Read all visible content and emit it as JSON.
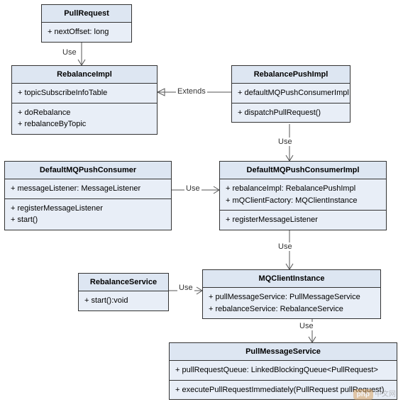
{
  "classes": {
    "pullRequest": {
      "name": "PullRequest",
      "attrs": [
        "+ nextOffset: long"
      ]
    },
    "rebalanceImpl": {
      "name": "RebalanceImpl",
      "attrs": [
        "+ topicSubscribeInfoTable"
      ],
      "methods": [
        "+ doRebalance",
        "+ rebalanceByTopic"
      ]
    },
    "rebalancePushImpl": {
      "name": "RebalancePushImpl",
      "attrs": [
        "+ defaultMQPushConsumerImpl"
      ],
      "methods": [
        "+ dispatchPullRequest()"
      ]
    },
    "defaultMQPushConsumer": {
      "name": "DefaultMQPushConsumer",
      "attrs": [
        "+ messageListener: MessageListener"
      ],
      "methods": [
        "+ registerMessageListener",
        "+ start()"
      ]
    },
    "defaultMQPushConsumerImpl": {
      "name": "DefaultMQPushConsumerImpl",
      "attrs": [
        "+ rebalanceImpl: RebalancePushImpl",
        "+ mQClientFactory:  MQClientInstance"
      ],
      "methods": [
        "+ registerMessageListener"
      ]
    },
    "rebalanceService": {
      "name": "RebalanceService",
      "methods": [
        "+ start():void"
      ]
    },
    "mqClientInstance": {
      "name": "MQClientInstance",
      "attrs": [
        "+ pullMessageService: PullMessageService",
        "+ rebalanceService: RebalanceService"
      ]
    },
    "pullMessageService": {
      "name": "PullMessageService",
      "attrs": [
        "+ pullRequestQueue: LinkedBlockingQueue<PullRequest>"
      ],
      "methods": [
        "+ executePullRequestImmediately(PullRequest pullRequest)"
      ]
    }
  },
  "labels": {
    "use": "Use",
    "extends": "Extends"
  },
  "watermark": {
    "badge": "php",
    "text": "中文网"
  }
}
